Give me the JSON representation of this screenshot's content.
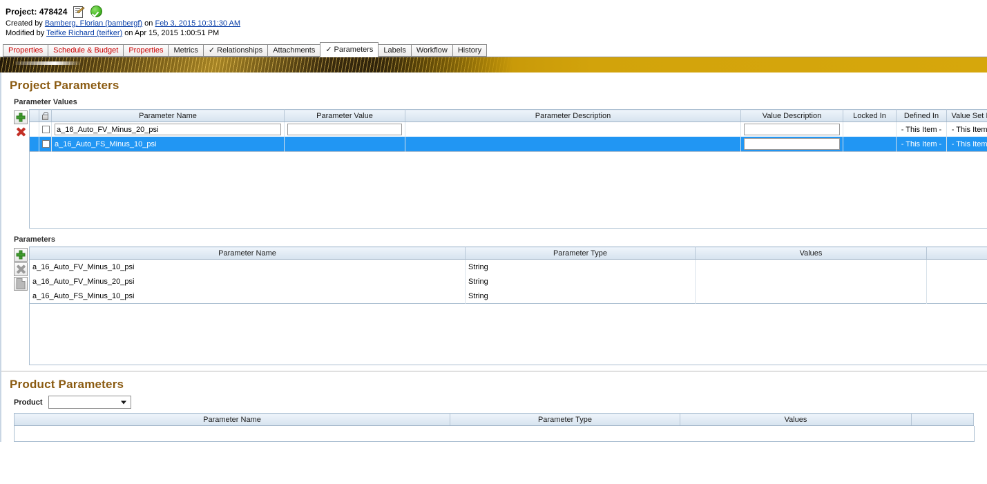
{
  "header": {
    "project_label": "Project: 478424",
    "edit_icon": "document-edit-icon",
    "status_icon": "green-check-icon",
    "created_prefix": "Created by ",
    "created_by": "Bamberg, Florian (bambergf)",
    "created_on_word": " on ",
    "created_date": "Feb 3, 2015 10:31:30 AM",
    "modified_prefix": "Modified by ",
    "modified_by": "Teifke Richard (teifker)",
    "modified_on_word": " on ",
    "modified_date": "Apr 15, 2015 1:00:51 PM"
  },
  "tabs": [
    {
      "label": "Properties",
      "style": "red",
      "active": false,
      "check": false
    },
    {
      "label": "Schedule & Budget",
      "style": "red",
      "active": false,
      "check": false
    },
    {
      "label": "Properties",
      "style": "red",
      "active": false,
      "check": false
    },
    {
      "label": "Metrics",
      "style": "dark",
      "active": false,
      "check": false
    },
    {
      "label": "Relationships",
      "style": "dark",
      "active": false,
      "check": true
    },
    {
      "label": "Attachments",
      "style": "dark",
      "active": false,
      "check": false
    },
    {
      "label": "Parameters",
      "style": "dark",
      "active": true,
      "check": true
    },
    {
      "label": "Labels",
      "style": "dark",
      "active": false,
      "check": false
    },
    {
      "label": "Workflow",
      "style": "dark",
      "active": false,
      "check": false
    },
    {
      "label": "History",
      "style": "dark",
      "active": false,
      "check": false
    }
  ],
  "page": {
    "title": "Project Parameters",
    "product_section_title": "Product Parameters"
  },
  "parameter_values": {
    "subtitle": "Parameter Values",
    "toolbar": {
      "add": "add-row-button",
      "delete": "delete-row-button"
    },
    "columns": [
      {
        "key": "lock",
        "label": ""
      },
      {
        "key": "check",
        "label": ""
      },
      {
        "key": "name",
        "label": "Parameter Name"
      },
      {
        "key": "value",
        "label": "Parameter Value"
      },
      {
        "key": "description",
        "label": "Parameter Description"
      },
      {
        "key": "value_description",
        "label": "Value Description"
      },
      {
        "key": "locked_in",
        "label": "Locked In"
      },
      {
        "key": "defined_in",
        "label": "Defined In"
      },
      {
        "key": "value_set_in",
        "label": "Value Set In"
      }
    ],
    "rows": [
      {
        "checked": false,
        "name": "a_16_Auto_FV_Minus_20_psi",
        "value": "",
        "description": "",
        "value_description": "",
        "locked_in": "",
        "defined_in": "- This Item -",
        "value_set_in": "- This Item -",
        "selected": false
      },
      {
        "checked": false,
        "name": "a_16_Auto_FS_Minus_10_psi",
        "value": "",
        "description": "",
        "value_description": "",
        "locked_in": "",
        "defined_in": "- This Item -",
        "value_set_in": "- This Item -",
        "selected": true
      }
    ]
  },
  "parameters": {
    "subtitle": "Parameters",
    "toolbar": {
      "add": "add-parameter-button",
      "delete": "delete-parameter-button",
      "copy": "copy-parameter-button"
    },
    "columns": [
      {
        "key": "name",
        "label": "Parameter Name"
      },
      {
        "key": "type",
        "label": "Parameter Type"
      },
      {
        "key": "values",
        "label": "Values"
      },
      {
        "key": "spacer",
        "label": ""
      }
    ],
    "rows": [
      {
        "name": "a_16_Auto_FV_Minus_10_psi",
        "type": "String",
        "values": ""
      },
      {
        "name": "a_16_Auto_FV_Minus_20_psi",
        "type": "String",
        "values": ""
      },
      {
        "name": "a_16_Auto_FS_Minus_10_psi",
        "type": "String",
        "values": ""
      }
    ]
  },
  "product_parameters": {
    "product_label": "Product",
    "product_value": "",
    "columns": [
      {
        "key": "name",
        "label": "Parameter Name"
      },
      {
        "key": "type",
        "label": "Parameter Type"
      },
      {
        "key": "values",
        "label": "Values"
      },
      {
        "key": "spacer",
        "label": ""
      }
    ],
    "rows": []
  },
  "colors": {
    "tab_red": "#cc0000",
    "heading_brown": "#8a5a10",
    "row_selected_blue": "#2196f3",
    "link_blue": "#0a3fa8",
    "banner_gold": "#d6a70c",
    "grid_header_blue": "#d6e3ef"
  }
}
